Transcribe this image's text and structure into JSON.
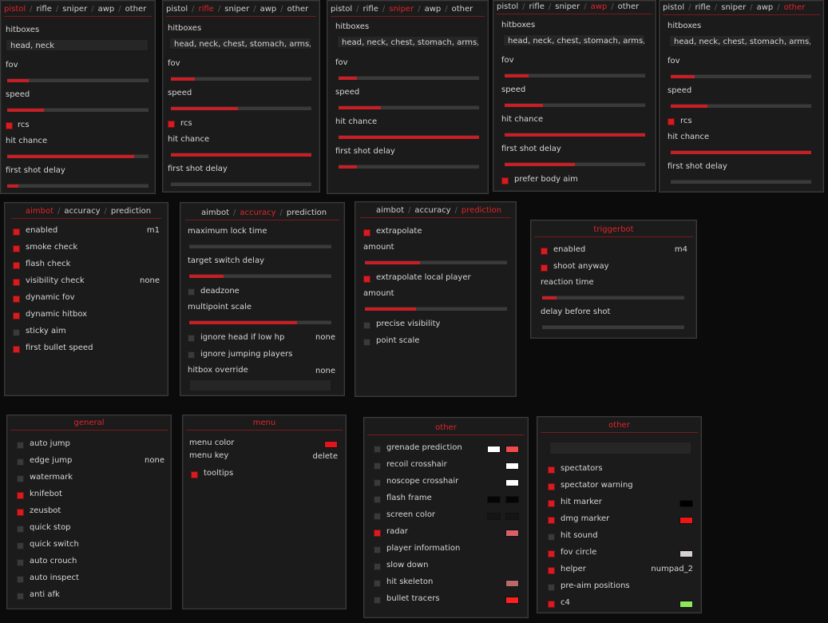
{
  "weapon_tabs": [
    "pistol",
    "rifle",
    "sniper",
    "awp",
    "other"
  ],
  "weapon_panels": [
    {
      "active": 0,
      "hitboxes_label": "hitboxes",
      "hitboxes_value": "head, neck",
      "fov": "fov",
      "fov_value": 0.15,
      "speed": "speed",
      "speed_value": 0.26,
      "rcs": "rcs",
      "rcs_on": true,
      "hit_chance": "hit chance",
      "hit_chance_value": 0.9,
      "first_shot_delay": "first shot delay",
      "first_shot_delay_value": 0.08
    },
    {
      "active": 1,
      "hitboxes_label": "hitboxes",
      "hitboxes_value": "head, neck, chest, stomach, arms, le",
      "fov": "fov",
      "fov_value": 0.17,
      "speed": "speed",
      "speed_value": 0.48,
      "rcs": "rcs",
      "rcs_on": true,
      "hit_chance": "hit chance",
      "hit_chance_value": 1.0,
      "first_shot_delay": "first shot delay",
      "first_shot_delay_value": 0.0
    },
    {
      "active": 2,
      "hitboxes_label": "hitboxes",
      "hitboxes_value": "head, neck, chest, stomach, arms, le",
      "fov": "fov",
      "fov_value": 0.13,
      "speed": "speed",
      "speed_value": 0.3,
      "hit_chance": "hit chance",
      "hit_chance_value": 1.0,
      "first_shot_delay": "first shot delay",
      "first_shot_delay_value": 0.13
    },
    {
      "active": 3,
      "hitboxes_label": "hitboxes",
      "hitboxes_value": "head, neck, chest, stomach, arms, le",
      "fov": "fov",
      "fov_value": 0.17,
      "speed": "speed",
      "speed_value": 0.27,
      "hit_chance": "hit chance",
      "hit_chance_value": 1.0,
      "first_shot_delay": "first shot delay",
      "first_shot_delay_value": 0.5,
      "prefer_body_aim": "prefer body aim",
      "prefer_body_aim_on": true
    },
    {
      "active": 4,
      "hitboxes_label": "hitboxes",
      "hitboxes_value": "head, neck, chest, stomach, arms, le",
      "fov": "fov",
      "fov_value": 0.17,
      "speed": "speed",
      "speed_value": 0.26,
      "rcs": "rcs",
      "rcs_on": true,
      "hit_chance": "hit chance",
      "hit_chance_value": 1.0,
      "first_shot_delay": "first shot delay",
      "first_shot_delay_value": 0.0
    }
  ],
  "aim_tabs": [
    "aimbot",
    "accuracy",
    "prediction"
  ],
  "aimbot": {
    "items": [
      {
        "label": "enabled",
        "on": true,
        "value": "m1"
      },
      {
        "label": "smoke check",
        "on": true
      },
      {
        "label": "flash check",
        "on": true
      },
      {
        "label": "visibility check",
        "on": true,
        "value": "none"
      },
      {
        "label": "dynamic fov",
        "on": true
      },
      {
        "label": "dynamic hitbox",
        "on": true
      },
      {
        "label": "sticky aim",
        "on": false
      },
      {
        "label": "first bullet speed",
        "on": true
      }
    ]
  },
  "accuracy": {
    "max_lock_time": "maximum lock time",
    "max_lock_time_value": 0.0,
    "target_switch_delay": "target switch delay",
    "target_switch_delay_value": 0.24,
    "deadzone": "deadzone",
    "deadzone_on": false,
    "multipoint_scale": "multipoint scale",
    "multipoint_scale_value": 0.76,
    "ignore_head": "ignore head if low hp",
    "ignore_head_on": false,
    "ignore_head_value": "none",
    "ignore_jumping": "ignore jumping players",
    "ignore_jumping_on": false,
    "hitbox_override": "hitbox override",
    "hitbox_override_value": "none"
  },
  "prediction": {
    "extrapolate": "extrapolate",
    "extrapolate_on": true,
    "amount_1": "amount",
    "amount_1_value": 0.39,
    "extrapolate_local": "extrapolate local player",
    "extrapolate_local_on": true,
    "amount_2": "amount",
    "amount_2_value": 0.36,
    "precise_visibility": "precise visibility",
    "precise_visibility_on": false,
    "point_scale": "point scale",
    "point_scale_on": false
  },
  "triggerbot": {
    "title": "triggerbot",
    "enabled": "enabled",
    "enabled_on": true,
    "enabled_key": "m4",
    "shoot_anyway": "shoot anyway",
    "shoot_anyway_on": true,
    "reaction_time": "reaction time",
    "reaction_time_value": 0.1,
    "delay_before_shot": "delay before shot",
    "delay_before_shot_value": 0.0
  },
  "general": {
    "title": "general",
    "items": [
      {
        "label": "auto jump",
        "on": false
      },
      {
        "label": "edge jump",
        "on": false,
        "value": "none"
      },
      {
        "label": "watermark",
        "on": false
      },
      {
        "label": "knifebot",
        "on": true
      },
      {
        "label": "zeusbot",
        "on": true
      },
      {
        "label": "quick stop",
        "on": false
      },
      {
        "label": "quick switch",
        "on": false
      },
      {
        "label": "auto crouch",
        "on": false
      },
      {
        "label": "auto inspect",
        "on": false
      },
      {
        "label": "anti afk",
        "on": false
      }
    ]
  },
  "menu": {
    "title": "menu",
    "menu_color": "menu color",
    "menu_color_value": "#e0151b",
    "menu_key": "menu key",
    "menu_key_value": "delete",
    "tooltips": "tooltips",
    "tooltips_on": true
  },
  "other_visuals": {
    "title": "other",
    "items": [
      {
        "label": "grenade prediction",
        "on": false,
        "colors": [
          "#ffffff",
          "#ef4a4a"
        ]
      },
      {
        "label": "recoil crosshair",
        "on": false,
        "colors": [
          "#ffffff"
        ]
      },
      {
        "label": "noscope crosshair",
        "on": false,
        "colors": [
          "#ffffff"
        ]
      },
      {
        "label": "flash frame",
        "on": false,
        "colors": [
          "#050505",
          "#050505"
        ]
      },
      {
        "label": "screen color",
        "on": false,
        "colors": [
          "#151515",
          "#151515"
        ]
      },
      {
        "label": "radar",
        "on": true,
        "colors": [
          "#d9606a"
        ]
      },
      {
        "label": "player information",
        "on": false
      },
      {
        "label": "slow down",
        "on": false
      },
      {
        "label": "hit skeleton",
        "on": false,
        "colors": [
          "#b86a6a"
        ]
      },
      {
        "label": "bullet tracers",
        "on": false,
        "colors": [
          "#ff2020"
        ]
      }
    ]
  },
  "other_misc": {
    "title": "other",
    "items": [
      {
        "label": "spectators",
        "on": true
      },
      {
        "label": "spectator warning",
        "on": true
      },
      {
        "label": "hit marker",
        "on": true,
        "colors": [
          "#000000"
        ]
      },
      {
        "label": "dmg marker",
        "on": true,
        "colors": [
          "#ee1515"
        ]
      },
      {
        "label": "hit sound",
        "on": false
      },
      {
        "label": "fov circle",
        "on": true,
        "colors": [
          "#d8d0d0"
        ]
      },
      {
        "label": "helper",
        "on": true,
        "value": "numpad_2"
      },
      {
        "label": "pre-aim positions",
        "on": false
      },
      {
        "label": "c4",
        "on": true,
        "colors": [
          "#8fe85a"
        ]
      }
    ]
  }
}
